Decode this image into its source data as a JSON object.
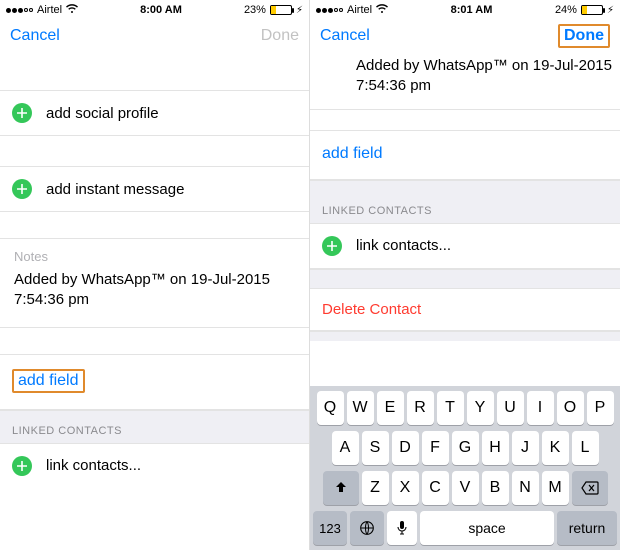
{
  "left": {
    "status": {
      "carrier": "Airtel",
      "time": "8:00 AM",
      "battery_pct": "23%"
    },
    "nav": {
      "cancel": "Cancel",
      "done": "Done"
    },
    "rows": {
      "social": "add social profile",
      "im": "add instant message"
    },
    "notes": {
      "label": "Notes",
      "text": "Added by WhatsApp™ on 19-Jul-2015 7:54:36 pm"
    },
    "add_field": "add field",
    "linked_header": "LINKED CONTACTS",
    "link_contacts": "link contacts..."
  },
  "right": {
    "status": {
      "carrier": "Airtel",
      "time": "8:01 AM",
      "battery_pct": "24%"
    },
    "nav": {
      "cancel": "Cancel",
      "done": "Done"
    },
    "notes_partial": "Added by WhatsApp™ on 19-Jul-2015\n7:54:36 pm",
    "add_field": "add field",
    "linked_header": "LINKED CONTACTS",
    "link_contacts": "link contacts...",
    "delete": "Delete Contact",
    "keyboard": {
      "r1": [
        "Q",
        "W",
        "E",
        "R",
        "T",
        "Y",
        "U",
        "I",
        "O",
        "P"
      ],
      "r2": [
        "A",
        "S",
        "D",
        "F",
        "G",
        "H",
        "J",
        "K",
        "L"
      ],
      "r3": [
        "Z",
        "X",
        "C",
        "V",
        "B",
        "N",
        "M"
      ],
      "num": "123",
      "space": "space",
      "ret": "return"
    }
  }
}
